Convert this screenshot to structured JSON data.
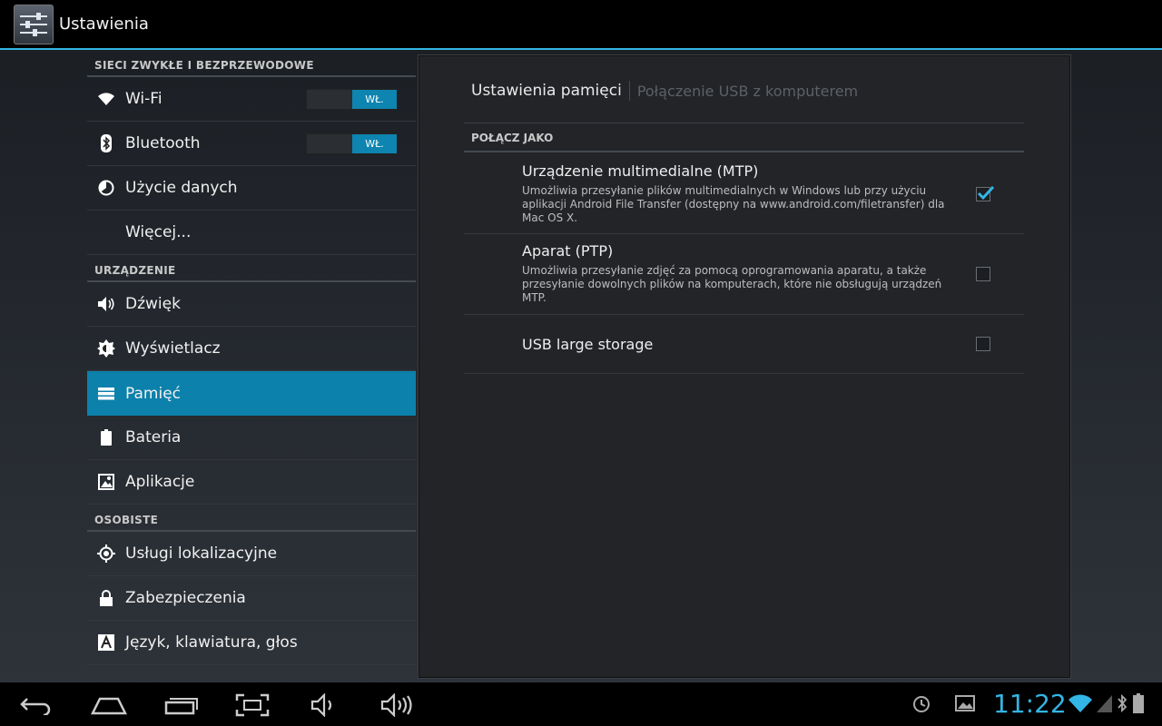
{
  "app": {
    "title": "Ustawienia"
  },
  "sidebar": {
    "sections": [
      {
        "header": "SIECI ZWYKŁE I BEZPRZEWODOWE"
      },
      {
        "header": "URZĄDZENIE"
      },
      {
        "header": "OSOBISTE"
      }
    ],
    "items": [
      {
        "label": "Wi-Fi",
        "icon": "wifi-icon",
        "toggle": "WŁ."
      },
      {
        "label": "Bluetooth",
        "icon": "bluetooth-icon",
        "toggle": "WŁ."
      },
      {
        "label": "Użycie danych",
        "icon": "data-usage-icon"
      },
      {
        "label": "Więcej..."
      },
      {
        "label": "Dźwięk",
        "icon": "volume-icon"
      },
      {
        "label": "Wyświetlacz",
        "icon": "brightness-icon"
      },
      {
        "label": "Pamięć",
        "icon": "storage-icon",
        "selected": true
      },
      {
        "label": "Bateria",
        "icon": "battery-icon"
      },
      {
        "label": "Aplikacje",
        "icon": "apps-icon"
      },
      {
        "label": "Usługi lokalizacyjne",
        "icon": "location-icon"
      },
      {
        "label": "Zabezpieczenia",
        "icon": "lock-icon"
      },
      {
        "label": "Język, klawiatura, głos",
        "icon": "language-icon"
      }
    ]
  },
  "panel": {
    "breadcrumb_main": "Ustawienia pamięci",
    "breadcrumb_sub": "Połączenie USB z komputerem",
    "section_header": "POŁĄCZ JAKO",
    "options": [
      {
        "title": "Urządzenie multimedialne (MTP)",
        "desc": "Umożliwia przesyłanie plików multimedialnych w Windows lub przy użyciu aplikacji Android File Transfer (dostępny na www.android.com/filetransfer) dla Mac OS X.",
        "checked": true
      },
      {
        "title": "Aparat (PTP)",
        "desc": "Umożliwia przesyłanie zdjęć za pomocą oprogramowania aparatu, a także przesyłanie dowolnych plików na komputerach, które nie obsługują urządzeń MTP.",
        "checked": false
      },
      {
        "title": "USB large storage",
        "desc": "",
        "checked": false
      }
    ]
  },
  "status_bar": {
    "time": "11:22"
  },
  "colors": {
    "accent": "#33b5e5",
    "selected": "#0c81ab"
  }
}
